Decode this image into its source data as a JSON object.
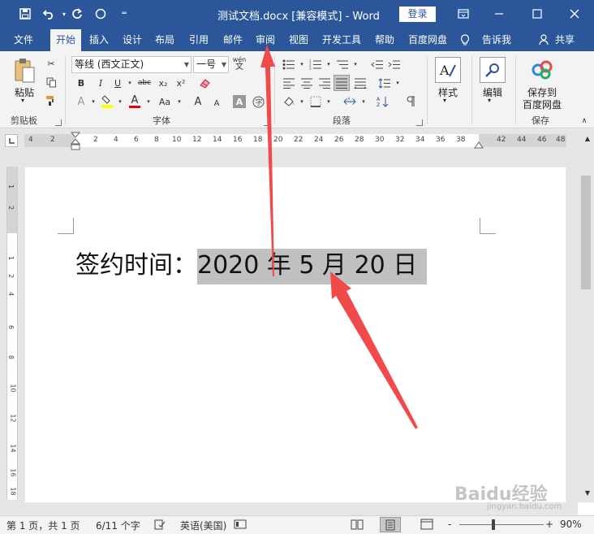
{
  "title_bar": {
    "document_title": "测试文档.docx [兼容模式] - Word",
    "login_label": "登录",
    "icons": [
      "save-icon",
      "undo-icon",
      "redo-icon",
      "circle-icon",
      "customize-icon",
      "ribbon-display-icon",
      "minimize-icon",
      "maximize-icon",
      "close-icon"
    ]
  },
  "tabs": [
    {
      "label": "文件",
      "active": false
    },
    {
      "label": "开始",
      "active": true
    },
    {
      "label": "插入",
      "active": false
    },
    {
      "label": "设计",
      "active": false
    },
    {
      "label": "布局",
      "active": false
    },
    {
      "label": "引用",
      "active": false
    },
    {
      "label": "邮件",
      "active": false
    },
    {
      "label": "审阅",
      "active": false
    },
    {
      "label": "视图",
      "active": false
    },
    {
      "label": "开发工具",
      "active": false
    },
    {
      "label": "帮助",
      "active": false
    },
    {
      "label": "百度网盘",
      "active": false
    },
    {
      "label": "告诉我",
      "active": false
    },
    {
      "label": "共享",
      "active": false
    }
  ],
  "ribbon": {
    "clipboard": {
      "group_label": "剪贴板",
      "paste_label": "粘贴"
    },
    "font": {
      "group_label": "字体",
      "font_name": "等线 (西文正文)",
      "font_size": "一号",
      "buttons": [
        "B",
        "I",
        "U",
        "abc",
        "x₂",
        "x²",
        "A",
        "A",
        "A",
        "Aa",
        "A",
        "A",
        "A"
      ],
      "phonetic": "wén",
      "phonetic_char": "文"
    },
    "paragraph": {
      "group_label": "段落"
    },
    "styles": {
      "label": "样式"
    },
    "editing": {
      "label": "编辑"
    },
    "save": {
      "group_label": "保存",
      "button_label_1": "保存到",
      "button_label_2": "百度网盘"
    }
  },
  "ruler": {
    "h_numbers_left": [
      "4",
      "2"
    ],
    "h_numbers": [
      "2",
      "4",
      "6",
      "8",
      "10",
      "12",
      "14",
      "16",
      "18",
      "20",
      "22",
      "24",
      "26",
      "28",
      "30",
      "32",
      "34",
      "36",
      "38"
    ],
    "h_numbers_right": [
      "42",
      "44",
      "46",
      "48"
    ],
    "v_numbers": [
      "1",
      "2",
      "1",
      "2",
      "4",
      "6",
      "8",
      "10",
      "12",
      "14",
      "16",
      "18"
    ]
  },
  "document": {
    "label_text": "签约时间：",
    "date_text": "2020 年 5 月 20 日"
  },
  "status_bar": {
    "page_info": "第 1 页，共 1 页",
    "word_count": "6/11 个字",
    "language": "英语(美国)",
    "zoom_minus": "-",
    "zoom_plus": "+",
    "zoom": "90%"
  },
  "watermark": {
    "text": "Baidu经验",
    "sub": "jingyan.baidu.com"
  },
  "colors": {
    "accent": "#2b579a",
    "annotation_arrow": "#f04a4a",
    "highlight": "#c0c0c0"
  }
}
